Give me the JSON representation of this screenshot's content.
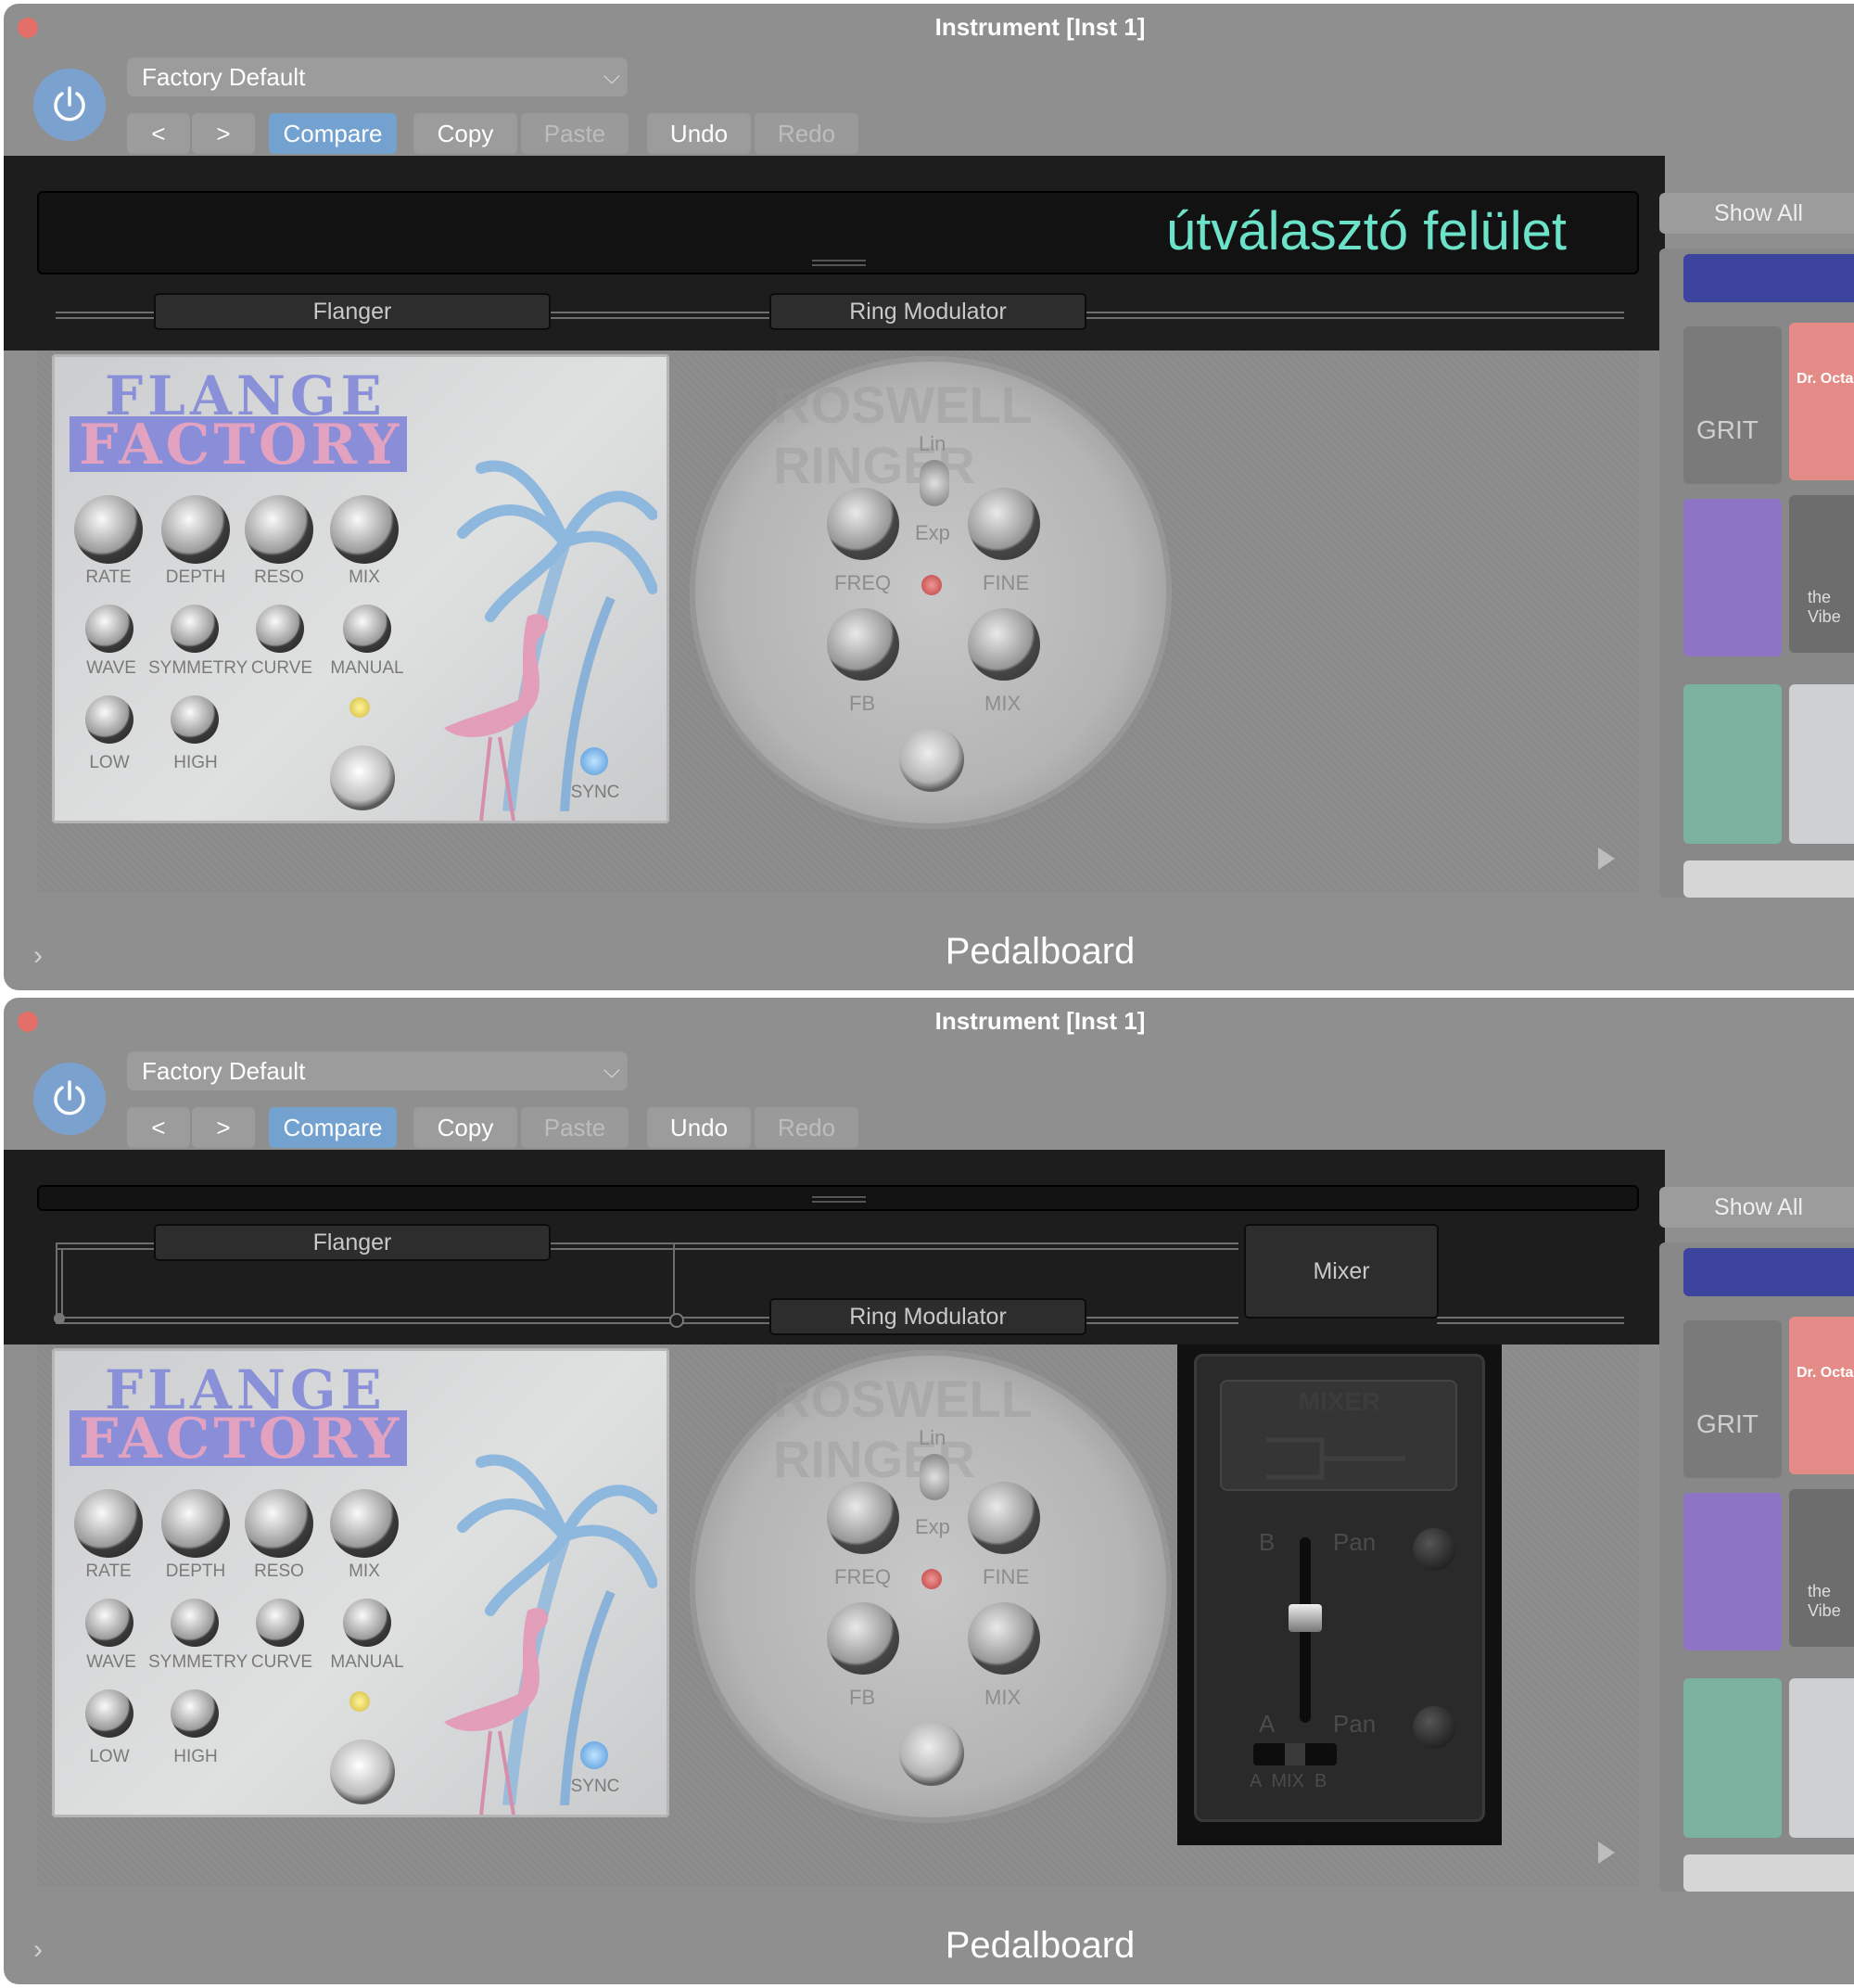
{
  "windows": [
    {
      "title": "Instrument [Inst 1]",
      "preset": "Factory Default",
      "buttons": {
        "compare": "Compare",
        "copy": "Copy",
        "paste": "Paste",
        "undo": "Undo",
        "redo": "Redo"
      },
      "routing_label": "útválasztó felület",
      "slots": {
        "flanger": "Flanger",
        "ring": "Ring Modulator"
      },
      "show_all": "Show All",
      "footer": "Pedalboard"
    },
    {
      "title": "Instrument [Inst 1]",
      "preset": "Factory Default",
      "buttons": {
        "compare": "Compare",
        "copy": "Copy",
        "paste": "Paste",
        "undo": "Undo",
        "redo": "Redo"
      },
      "slots": {
        "flanger": "Flanger",
        "ring": "Ring Modulator",
        "mixer": "Mixer"
      },
      "show_all": "Show All",
      "footer": "Pedalboard",
      "mixer_pedal": {
        "title": "MIXER",
        "b": "B",
        "a": "A",
        "pan_b": "Pan",
        "pan_a": "Pan",
        "mix": "A  MIX  B"
      }
    }
  ],
  "flanger_pedal": {
    "name1": "FLANGE",
    "name2": "FACTORY",
    "knobs_row1": [
      "RATE",
      "DEPTH",
      "RESO",
      "MIX"
    ],
    "knobs_row2": [
      "WAVE",
      "SYMMETRY",
      "CURVE",
      "MANUAL"
    ],
    "knobs_row3": [
      "LOW",
      "HIGH"
    ],
    "sync": "SYNC"
  },
  "ring_pedal": {
    "name": "ROSWELL RINGER",
    "lin": "Lin",
    "exp": "Exp",
    "freq": "FREQ",
    "fine": "FINE",
    "fb": "FB",
    "mix": "MIX"
  },
  "sidebar_thumbs": [
    "GRIT",
    "Dr. Octa",
    "the Vibe"
  ],
  "colors": {
    "accent": "#73a2d1",
    "routing_text": "#6ce2c9",
    "window_bg": "#8f8f8f",
    "dark_band": "#1d1d1d"
  }
}
